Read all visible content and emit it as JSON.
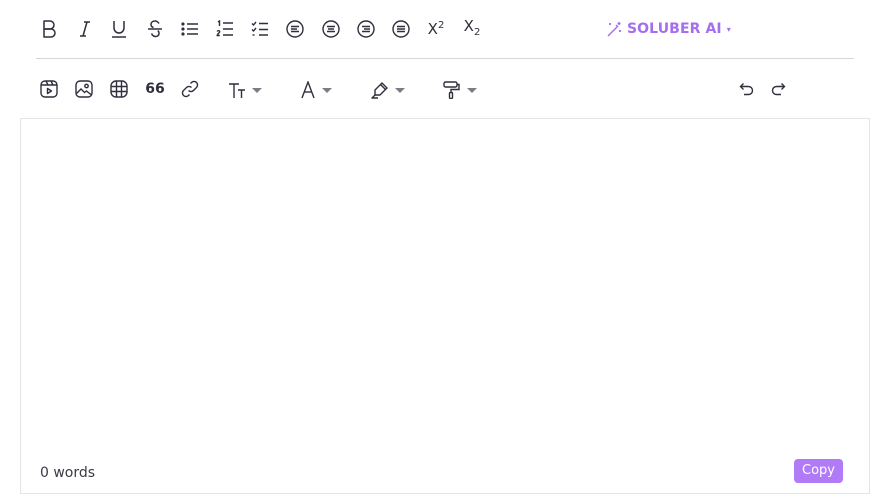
{
  "toolbar": {
    "ai_label": "SOLUBER AI",
    "quote_label": "66",
    "superscript": {
      "base": "X",
      "exp": "2"
    },
    "subscript": {
      "base": "X",
      "exp": "2"
    },
    "icons_row1": [
      "bold-icon",
      "italic-icon",
      "underline-icon",
      "strikethrough-icon",
      "bullet-list-icon",
      "numbered-list-icon",
      "checklist-icon",
      "align-left-icon",
      "align-center-icon",
      "align-right-icon",
      "align-justify-icon",
      "superscript-icon",
      "subscript-icon"
    ],
    "icons_row2": [
      "video-icon",
      "image-icon",
      "table-icon",
      "quote-icon",
      "link-icon",
      "font-size-icon",
      "font-color-icon",
      "highlight-icon",
      "format-painter-icon",
      "undo-icon",
      "redo-icon"
    ]
  },
  "editor": {
    "word_count": "0 words",
    "copy_label": "Copy"
  },
  "colors": {
    "accent": "#b17bf7",
    "ai_text": "#a46ef0",
    "icon": "#2f2f3d"
  }
}
